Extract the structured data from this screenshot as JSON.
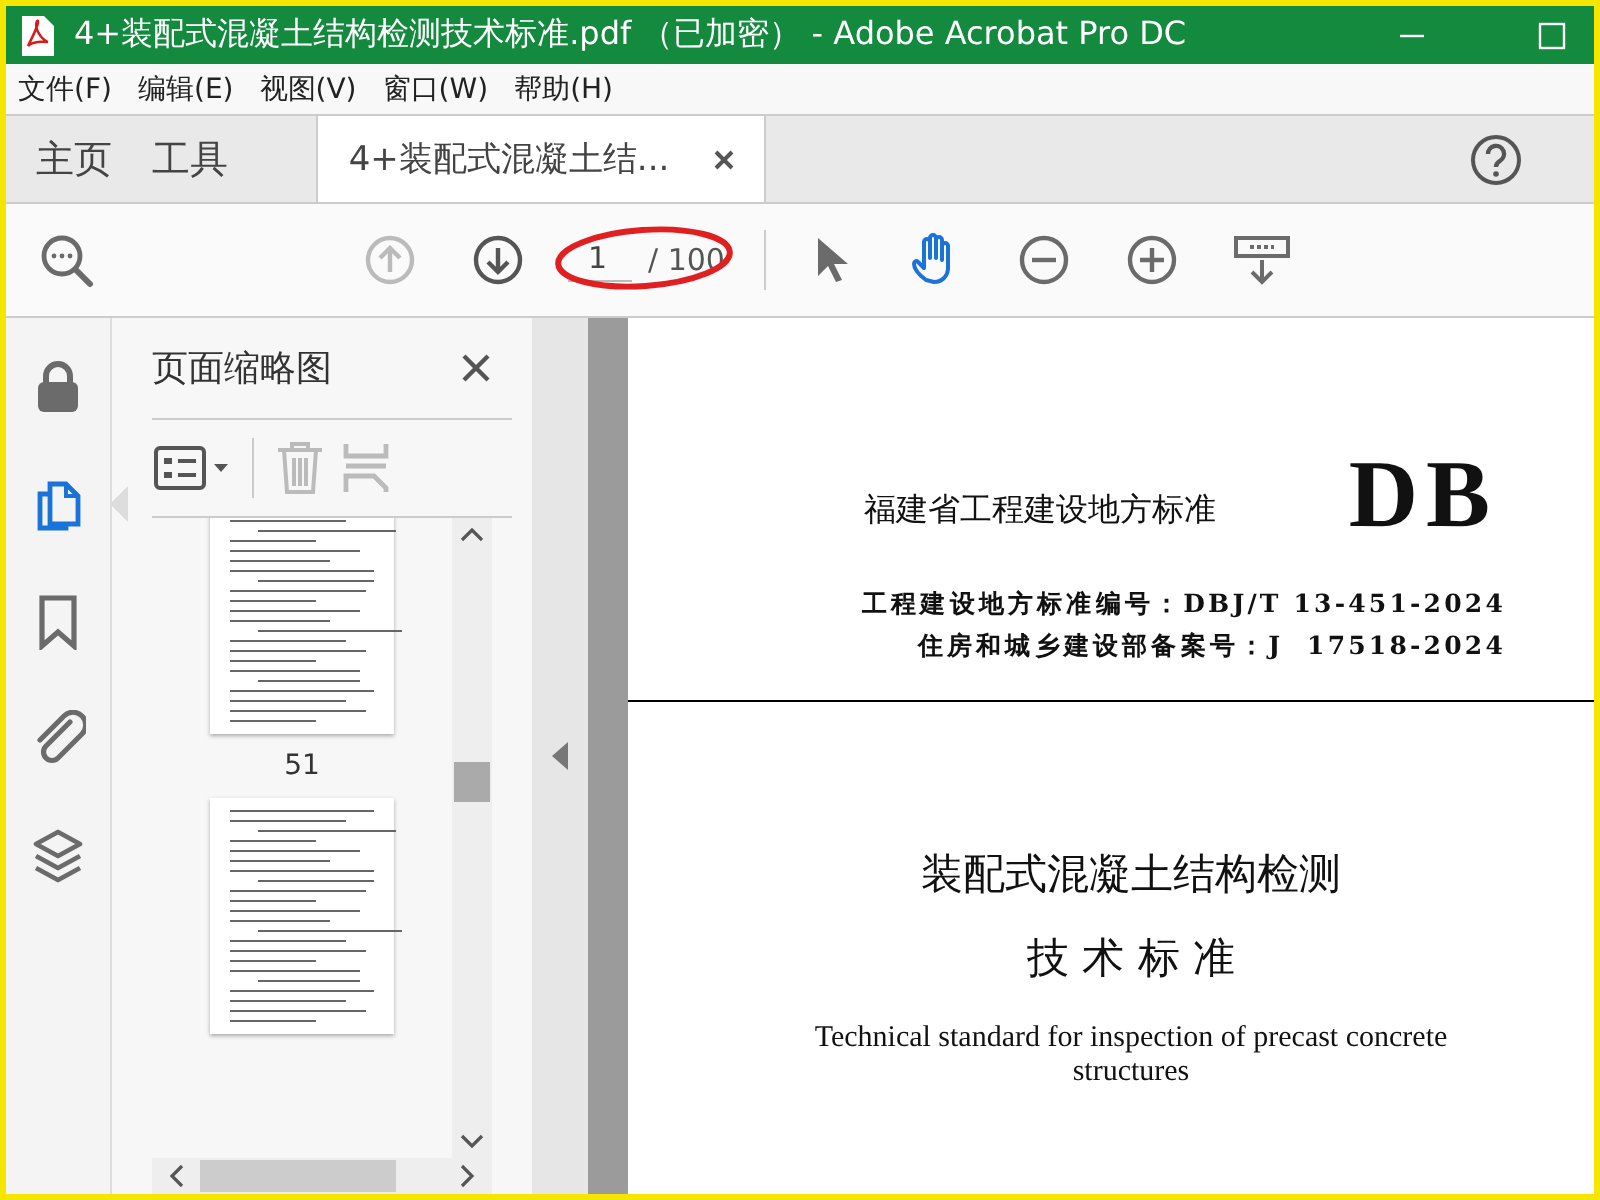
{
  "window": {
    "title": "4+装配式混凝土结构检测技术标准.pdf （已加密） - Adobe Acrobat Pro DC"
  },
  "menu": [
    "文件(F)",
    "编辑(E)",
    "视图(V)",
    "窗口(W)",
    "帮助(H)"
  ],
  "tabs": [
    {
      "label": "主页",
      "selected": false
    },
    {
      "label": "工具",
      "selected": false
    },
    {
      "label": "4+装配式混凝土结...",
      "selected": true
    }
  ],
  "toolbar": {
    "page_number": "1",
    "page_total": "/ 100",
    "hand_tool_selected": true
  },
  "sidebar": {
    "items": [
      {
        "kind": "lock",
        "selected": false
      },
      {
        "kind": "pages",
        "selected": true
      },
      {
        "kind": "bookmark",
        "selected": false
      },
      {
        "kind": "attachment",
        "selected": false
      },
      {
        "kind": "layers",
        "selected": false
      }
    ]
  },
  "thumbnails_panel": {
    "title": "页面缩略图",
    "pages": [
      {
        "label": "51",
        "selected": false
      },
      {
        "selected": false
      }
    ]
  },
  "document": {
    "header": "福建省工程建设地方标准",
    "logo": "DB",
    "codes": [
      "工程建设地方标准编号：DBJ/T 13-451-2024",
      "住房和城乡建设部备案号：J  17518-2024"
    ],
    "title_lines": [
      "装配式混凝土结构检测",
      "技 术 标 准"
    ],
    "english_title": "Technical standard for inspection of precast concrete structures"
  }
}
